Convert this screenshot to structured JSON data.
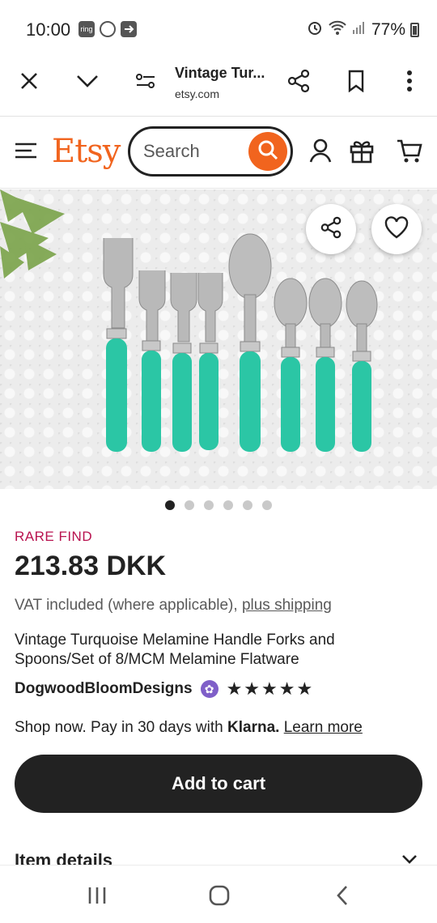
{
  "status_bar": {
    "time": "10:00",
    "left_icons": [
      "ring-icon",
      "smiley-icon",
      "arrow-in-box-icon"
    ],
    "ring_label": "ring",
    "right_icons": [
      "alarm-icon",
      "wifi-icon",
      "signal-icon",
      "battery-icon"
    ],
    "battery": "77%"
  },
  "browser_bar": {
    "page_title": "Vintage Tur...",
    "domain": "etsy.com",
    "icons": [
      "close-icon",
      "chevron-down-icon",
      "page-settings-icon",
      "share-icon",
      "bookmark-icon",
      "more-vert-icon"
    ]
  },
  "etsy_header": {
    "logo": "Etsy",
    "search_placeholder": "Search",
    "brand_color": "#f1641e",
    "icons": [
      "menu-icon",
      "search-icon",
      "account-icon",
      "gift-icon",
      "cart-icon"
    ]
  },
  "hero": {
    "overlay_icons": [
      "share-icon",
      "heart-icon"
    ],
    "slide_count": 6,
    "active_slide": 1
  },
  "product": {
    "badge": "RARE FIND",
    "badge_color": "#b8124f",
    "price": "213.83 DKK",
    "vat_text": "VAT included (where applicable), ",
    "vat_link": "plus shipping",
    "title": "Vintage Turquoise Melamine Handle Forks and Spoons/Set of 8/MCM Melamine Flatware",
    "shop_name": "DogwoodBloomDesigns",
    "stars": "★★★★★",
    "rating": 5,
    "klarna_prefix": "Shop now. Pay in 30 days with ",
    "klarna_brand": "Klarna.",
    "klarna_link": "Learn more",
    "add_to_cart": "Add to cart",
    "item_details": "Item details"
  },
  "nav_bar": {
    "icons": [
      "recents-icon",
      "home-icon",
      "back-icon"
    ]
  }
}
